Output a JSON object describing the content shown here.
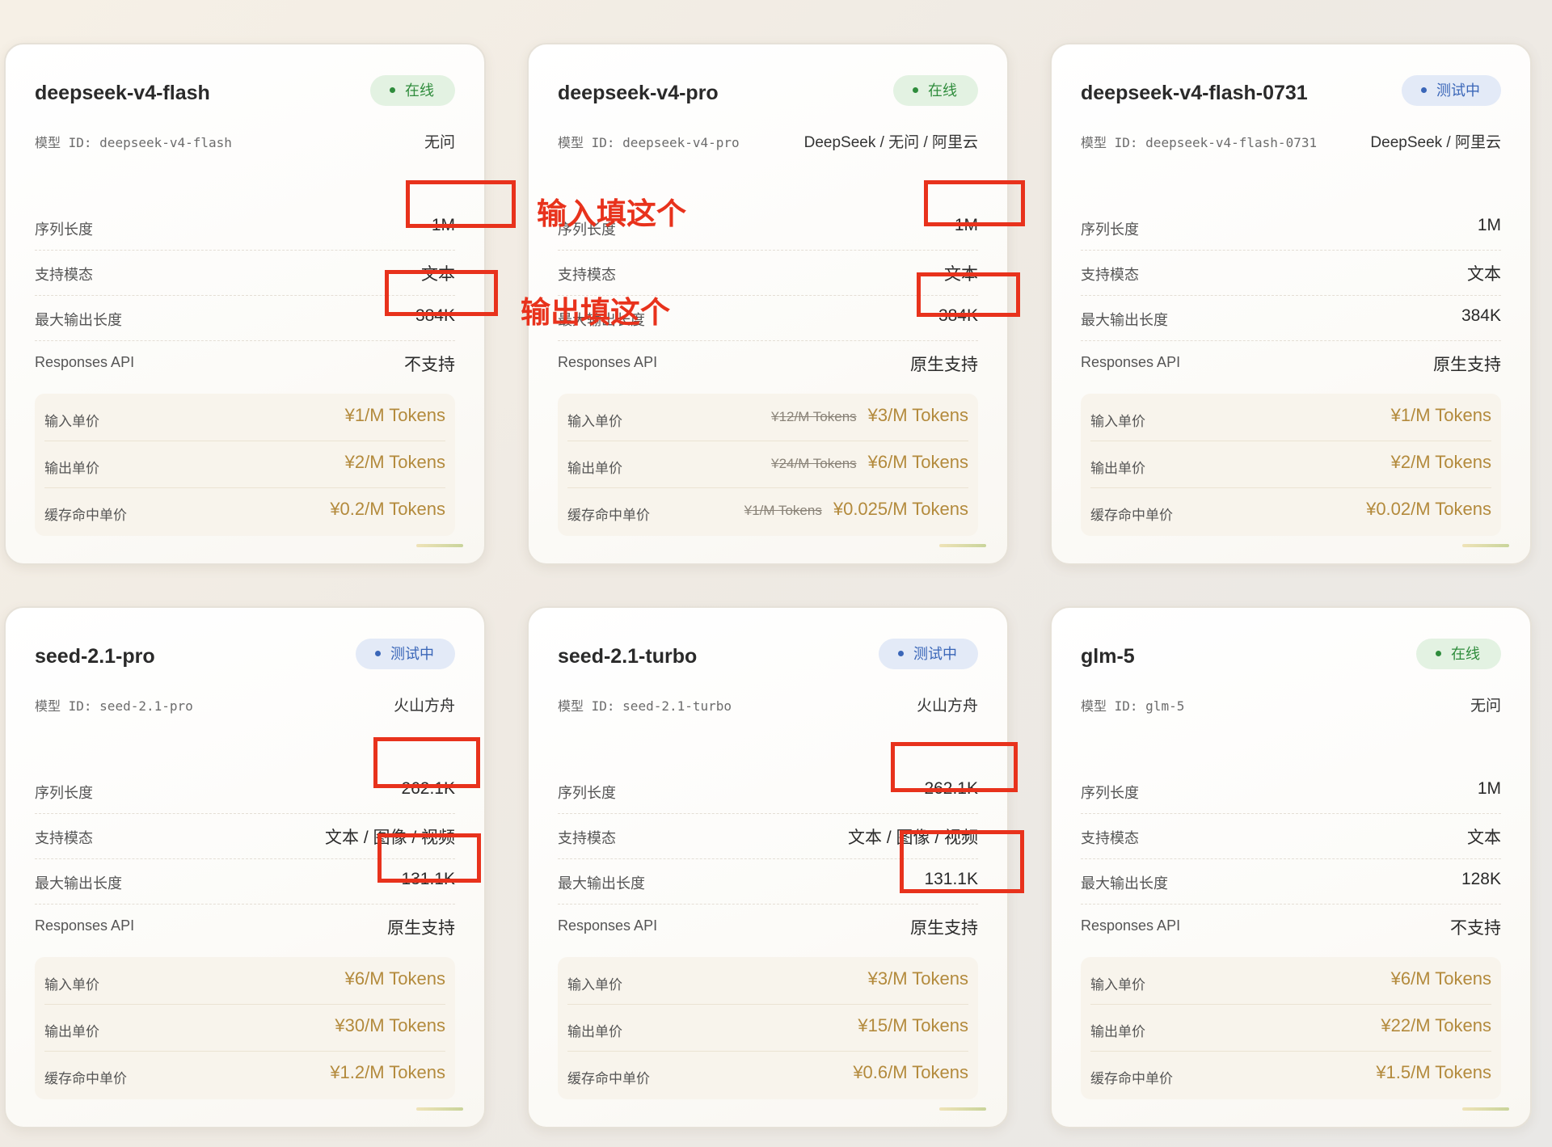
{
  "labels": {
    "id_prefix": "模型 ID: ",
    "seq_len": "序列长度",
    "modality": "支持模态",
    "max_output": "最大输出长度",
    "responses_api": "Responses API",
    "input_price": "输入单价",
    "output_price": "输出单价",
    "cache_price": "缓存命中单价"
  },
  "annotations": {
    "input_note": "输入填这个",
    "output_note": "输出填这个"
  },
  "colors": {
    "online": "#2f8c3c",
    "testing": "#3a66b8",
    "price": "#b38a3c",
    "highlight": "#e8321c"
  },
  "cards": [
    {
      "name": "deepseek-v4-flash",
      "status": "在线",
      "status_type": "online",
      "model_id": "deepseek-v4-flash",
      "provider": "无问",
      "seq_len": "1M",
      "modality": "文本",
      "max_output": "384K",
      "responses_api": "不支持",
      "input_price_old": "",
      "input_price": "¥1/M Tokens",
      "output_price_old": "",
      "output_price": "¥2/M Tokens",
      "cache_price_old": "",
      "cache_price": "¥0.2/M Tokens"
    },
    {
      "name": "deepseek-v4-pro",
      "status": "在线",
      "status_type": "online",
      "model_id": "deepseek-v4-pro",
      "provider": "DeepSeek / 无问 / 阿里云",
      "seq_len": "1M",
      "modality": "文本",
      "max_output": "384K",
      "responses_api": "原生支持",
      "input_price_old": "¥12/M Tokens",
      "input_price": "¥3/M Tokens",
      "output_price_old": "¥24/M Tokens",
      "output_price": "¥6/M Tokens",
      "cache_price_old": "¥1/M Tokens",
      "cache_price": "¥0.025/M Tokens"
    },
    {
      "name": "deepseek-v4-flash-0731",
      "status": "测试中",
      "status_type": "testing",
      "model_id": "deepseek-v4-flash-0731",
      "provider": "DeepSeek / 阿里云",
      "seq_len": "1M",
      "modality": "文本",
      "max_output": "384K",
      "responses_api": "原生支持",
      "input_price_old": "",
      "input_price": "¥1/M Tokens",
      "output_price_old": "",
      "output_price": "¥2/M Tokens",
      "cache_price_old": "",
      "cache_price": "¥0.02/M Tokens"
    },
    {
      "name": "seed-2.1-pro",
      "status": "测试中",
      "status_type": "testing",
      "model_id": "seed-2.1-pro",
      "provider": "火山方舟",
      "seq_len": "262.1K",
      "modality": "文本 / 图像 / 视频",
      "max_output": "131.1K",
      "responses_api": "原生支持",
      "input_price_old": "",
      "input_price": "¥6/M Tokens",
      "output_price_old": "",
      "output_price": "¥30/M Tokens",
      "cache_price_old": "",
      "cache_price": "¥1.2/M Tokens"
    },
    {
      "name": "seed-2.1-turbo",
      "status": "测试中",
      "status_type": "testing",
      "model_id": "seed-2.1-turbo",
      "provider": "火山方舟",
      "seq_len": "262.1K",
      "modality": "文本 / 图像 / 视频",
      "max_output": "131.1K",
      "responses_api": "原生支持",
      "input_price_old": "",
      "input_price": "¥3/M Tokens",
      "output_price_old": "",
      "output_price": "¥15/M Tokens",
      "cache_price_old": "",
      "cache_price": "¥0.6/M Tokens"
    },
    {
      "name": "glm-5",
      "status": "在线",
      "status_type": "online",
      "model_id": "glm-5",
      "provider": "无问",
      "seq_len": "1M",
      "modality": "文本",
      "max_output": "128K",
      "responses_api": "不支持",
      "input_price_old": "",
      "input_price": "¥6/M Tokens",
      "output_price_old": "",
      "output_price": "¥22/M Tokens",
      "cache_price_old": "",
      "cache_price": "¥1.5/M Tokens"
    }
  ]
}
